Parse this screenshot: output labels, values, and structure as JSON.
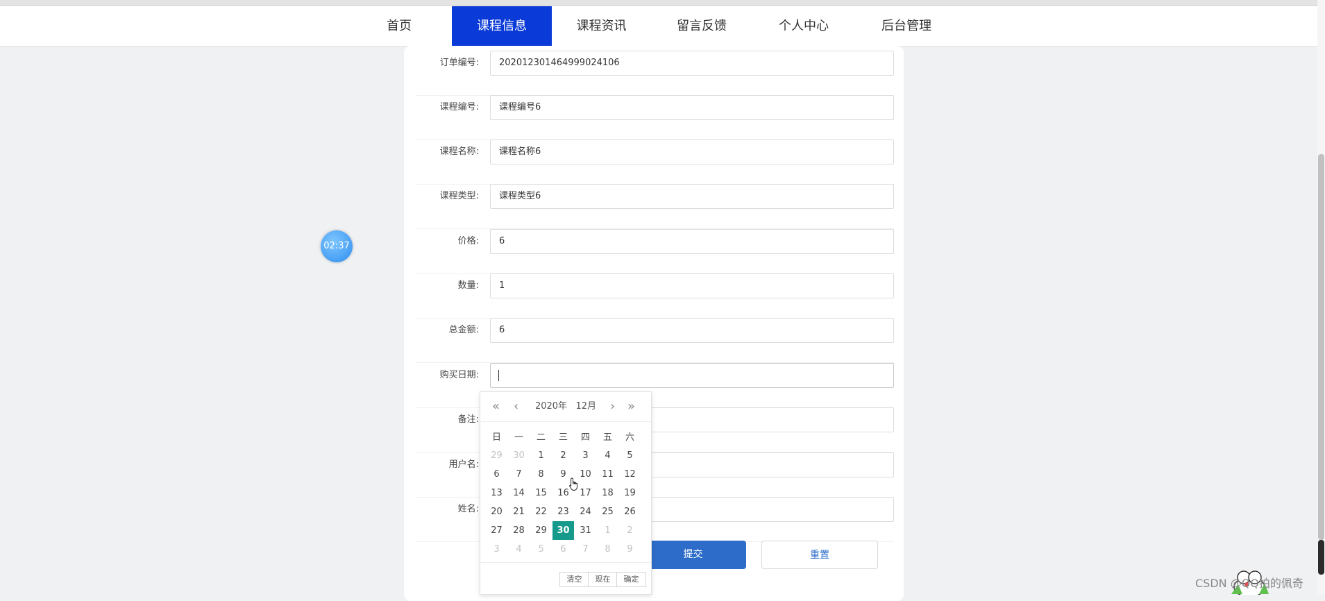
{
  "nav": {
    "items": [
      {
        "label": "首页"
      },
      {
        "label": "课程信息",
        "active": true
      },
      {
        "label": "课程资讯"
      },
      {
        "label": "留言反馈"
      },
      {
        "label": "个人中心"
      },
      {
        "label": "后台管理"
      }
    ]
  },
  "timer": {
    "text": "02:37"
  },
  "form": {
    "fields": [
      {
        "label": "订单编号:",
        "value": "202012301464999024106"
      },
      {
        "label": "课程编号:",
        "value": "课程编号6"
      },
      {
        "label": "课程名称:",
        "value": "课程名称6"
      },
      {
        "label": "课程类型:",
        "value": "课程类型6"
      },
      {
        "label": "价格:",
        "value": "6"
      },
      {
        "label": "数量:",
        "value": "1"
      },
      {
        "label": "总金额:",
        "value": "6"
      },
      {
        "label": "购买日期:",
        "value": ""
      },
      {
        "label": "备注:",
        "value": ""
      },
      {
        "label": "用户名:",
        "value": ""
      },
      {
        "label": "姓名:",
        "value": ""
      }
    ],
    "submit_label": "提交",
    "reset_label": "重置"
  },
  "datepicker": {
    "prev_year": "«",
    "prev_month": "‹",
    "next_month": "›",
    "next_year": "»",
    "year": "2020年",
    "month": "12月",
    "weekdays": [
      "日",
      "一",
      "二",
      "三",
      "四",
      "五",
      "六"
    ],
    "weeks": [
      [
        "29",
        "30",
        "1",
        "2",
        "3",
        "4",
        "5"
      ],
      [
        "6",
        "7",
        "8",
        "9",
        "10",
        "11",
        "12"
      ],
      [
        "13",
        "14",
        "15",
        "16",
        "17",
        "18",
        "19"
      ],
      [
        "20",
        "21",
        "22",
        "23",
        "24",
        "25",
        "26"
      ],
      [
        "27",
        "28",
        "29",
        "30",
        "31",
        "1",
        "2"
      ],
      [
        "3",
        "4",
        "5",
        "6",
        "7",
        "8",
        "9"
      ]
    ],
    "selected": "30",
    "clear_label": "清空",
    "now_label": "现在",
    "confirm_label": "确定"
  },
  "watermark": {
    "text": "CSDN @QQ拍的佩奇"
  }
}
